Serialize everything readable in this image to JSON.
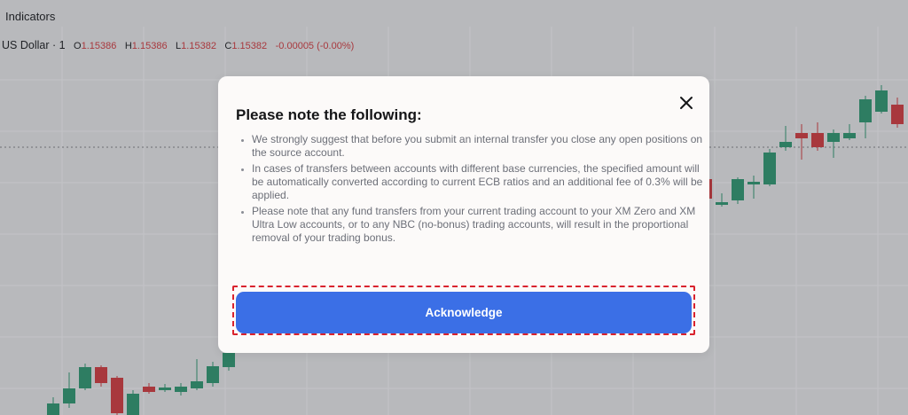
{
  "toolbar": {
    "indicators_label": "Indicators"
  },
  "legend": {
    "symbol": "US Dollar · 1",
    "open_label": "O",
    "open_value": "1.15386",
    "high_label": "H",
    "high_value": "1.15386",
    "low_label": "L",
    "low_value": "1.15382",
    "close_label": "C",
    "close_value": "1.15382",
    "change": "-0.00005 (-0.00%)"
  },
  "modal": {
    "title": "Please note the following:",
    "notes": [
      "We strongly suggest that before you submit an internal transfer you close any open positions on the source account.",
      "In cases of transfers between accounts with different base currencies, the specified amount will be automatically converted according to current ECB ratios and an additional fee of 0.3% will be applied.",
      "Please note that any fund transfers from your current trading account to your XM Zero and XM Ultra Low accounts, or to any NBC (no-bonus) trading accounts, will result in the proportional removal of your trading bonus."
    ],
    "acknowledge_label": "Acknowledge",
    "close_icon": "close-icon"
  },
  "colors": {
    "up_candle": "#2e7d62",
    "down_candle": "#a8383d",
    "button": "#3b6fe6",
    "focus_frame": "#d9232e"
  }
}
